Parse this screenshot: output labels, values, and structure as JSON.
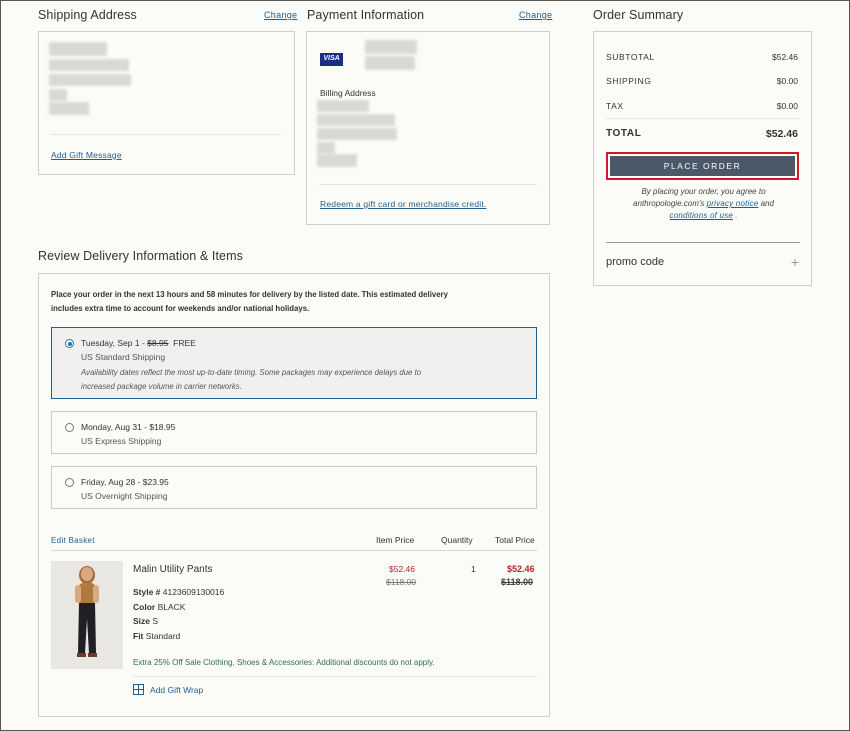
{
  "shipping": {
    "title": "Shipping Address",
    "change": "Change",
    "add_gift_message": "Add Gift Message"
  },
  "payment": {
    "title": "Payment Information",
    "change": "Change",
    "card_brand": "VISA",
    "billing_label": "Billing Address",
    "redeem_link": "Redeem a gift card or merchandise credit."
  },
  "summary": {
    "title": "Order Summary",
    "subtotal_label": "SUBTOTAL",
    "subtotal_value": "$52.46",
    "shipping_label": "SHIPPING",
    "shipping_value": "$0.00",
    "tax_label": "TAX",
    "tax_value": "$0.00",
    "total_label": "TOTAL",
    "total_value": "$52.46",
    "place_order": "PLACE ORDER",
    "agree_1": "By placing your order, you agree to",
    "agree_2a": "anthropologie.com's",
    "privacy": "privacy notice",
    "agree_2b": "and",
    "conditions": "conditions of use",
    "agree_3b": ".",
    "promo_label": "promo code",
    "promo_toggle": "+"
  },
  "delivery": {
    "title": "Review Delivery Information & Items",
    "notice_line1": "Place your order in the next 13 hours and 58 minutes for delivery by the listed date. This estimated delivery",
    "notice_line2": "includes extra time to account for weekends and/or national holidays.",
    "options": [
      {
        "date_prefix": "Tuesday, Sep 1 - ",
        "old_price": "$8.95",
        "new_price": "FREE",
        "method": "US Standard Shipping",
        "note1": "Availability dates reflect the most up-to-date timing. Some packages may experience delays due to",
        "note2": "increased package volume in carrier networks."
      },
      {
        "date": "Monday, Aug 31 - $18.95",
        "method": "US Express Shipping"
      },
      {
        "date": "Friday, Aug 28 - $23.95",
        "method": "US Overnight Shipping"
      }
    ]
  },
  "items": {
    "edit_basket": "Edit Basket",
    "col_item_price": "Item Price",
    "col_quantity": "Quantity",
    "col_total_price": "Total Price",
    "product": {
      "name": "Malin Utility Pants",
      "style_label": "Style #",
      "style_value": "4123609130016",
      "color_label": "Color",
      "color_value": "BLACK",
      "size_label": "Size",
      "size_value": "S",
      "fit_label": "Fit",
      "fit_value": "Standard",
      "item_price_sale": "$52.46",
      "item_price_orig": "$118.00",
      "quantity": "1",
      "total_sale": "$52.46",
      "total_orig": "$118.00",
      "promo_text": "Extra 25% Off Sale Clothing, Shoes & Accessories: Additional discounts do not apply.",
      "add_gift_wrap": "Add Gift Wrap"
    }
  },
  "colors": {
    "accent_link": "#1f5f8f",
    "place_order_bg": "#4a5868",
    "sale_red": "#b5262c",
    "promo_teal": "#2f6e62",
    "highlight_outline": "#d3182a"
  }
}
